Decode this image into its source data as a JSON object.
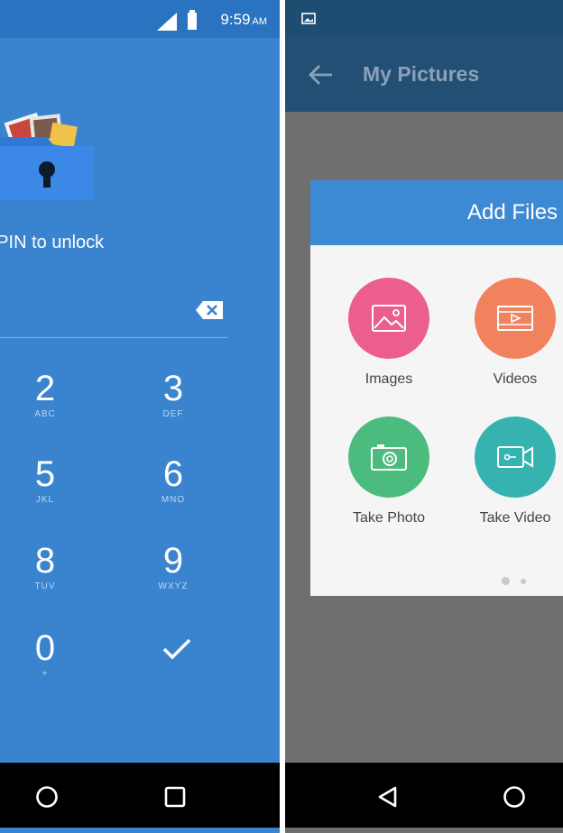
{
  "left_screen": {
    "status_time": "9:59",
    "status_ampm": "AM",
    "pin_prompt": "r PIN to unlock",
    "keypad": [
      {
        "digit": "2",
        "letters": "ABC"
      },
      {
        "digit": "3",
        "letters": "DEF"
      },
      {
        "digit": "5",
        "letters": "JKL"
      },
      {
        "digit": "6",
        "letters": "MNO"
      },
      {
        "digit": "8",
        "letters": "TUV"
      },
      {
        "digit": "9",
        "letters": "WXYZ"
      },
      {
        "digit": "0",
        "letters": "+"
      }
    ],
    "colors": {
      "background": "#3a83cf",
      "status_bar": "#2a73c0"
    },
    "icons": [
      "folder-lock-icon",
      "backspace-icon",
      "check-icon",
      "home-nav-icon",
      "recents-nav-icon",
      "signal-icon",
      "battery-icon"
    ]
  },
  "right_screen": {
    "app_title": "My Pictures",
    "dialog_title": "Add Files",
    "options": [
      {
        "label": "Images",
        "color": "#ec5f8c",
        "icon": "image-icon"
      },
      {
        "label": "Videos",
        "color": "#f0825e",
        "icon": "video-file-icon"
      },
      {
        "label": "Take Photo",
        "color": "#4cbc7e",
        "icon": "camera-icon"
      },
      {
        "label": "Take Video",
        "color": "#36b3b0",
        "icon": "video-camera-icon"
      }
    ],
    "page_indicator": {
      "pages": 2,
      "current": 1
    },
    "colors": {
      "app_bar": "#244f74",
      "dialog_header": "#3c8ad3",
      "scrim": "#6f6f6f"
    },
    "icons": [
      "back-arrow-icon",
      "notification-image-icon",
      "back-nav-icon",
      "home-nav-icon"
    ]
  }
}
